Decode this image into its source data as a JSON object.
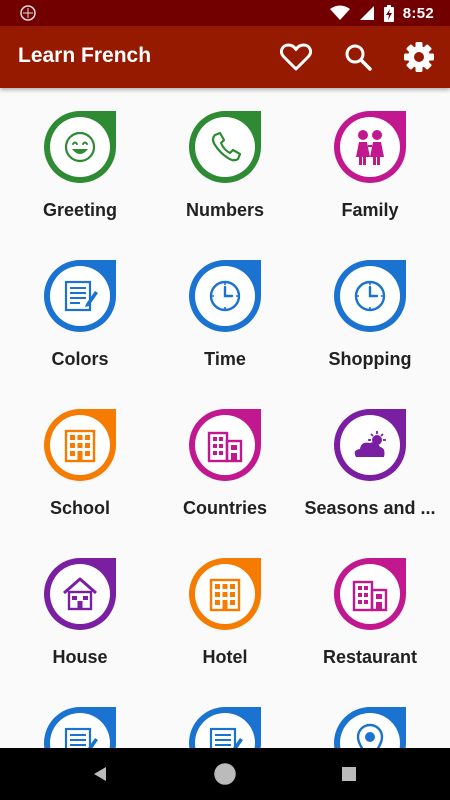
{
  "status_bar": {
    "time": "8:52",
    "icons": [
      "notification-icon",
      "wifi-icon",
      "signal-icon",
      "battery-charging-icon"
    ]
  },
  "app_bar": {
    "title": "Learn French",
    "actions": [
      "heart-icon",
      "search-icon",
      "settings-icon"
    ],
    "color": "#961a00"
  },
  "categories": [
    {
      "label": "Greeting",
      "icon": "smiley-icon",
      "color": "#2e8b34"
    },
    {
      "label": "Numbers",
      "icon": "phone-icon",
      "color": "#2e8b34"
    },
    {
      "label": "Family",
      "icon": "family-icon",
      "color": "#c2188f"
    },
    {
      "label": "Colors",
      "icon": "document-icon",
      "color": "#1a73d1"
    },
    {
      "label": "Time",
      "icon": "clock-icon",
      "color": "#1a73d1"
    },
    {
      "label": "Shopping",
      "icon": "clock-icon",
      "color": "#1a73d1"
    },
    {
      "label": "School",
      "icon": "building-icon",
      "color": "#f57c00"
    },
    {
      "label": "Countries",
      "icon": "city-icon",
      "color": "#c2188f"
    },
    {
      "label": "Seasons and ...",
      "icon": "weather-icon",
      "color": "#7b1fa2"
    },
    {
      "label": "House",
      "icon": "house-icon",
      "color": "#7b1fa2"
    },
    {
      "label": "Hotel",
      "icon": "building-icon",
      "color": "#f57c00"
    },
    {
      "label": "Restaurant",
      "icon": "city-icon",
      "color": "#c2188f"
    },
    {
      "label": "",
      "icon": "document-icon",
      "color": "#1a73d1"
    },
    {
      "label": "",
      "icon": "document-icon",
      "color": "#1a73d1"
    },
    {
      "label": "",
      "icon": "location-icon",
      "color": "#1a73d1"
    }
  ],
  "nav_bar": {
    "buttons": [
      "back-icon",
      "home-icon",
      "recents-icon"
    ]
  }
}
